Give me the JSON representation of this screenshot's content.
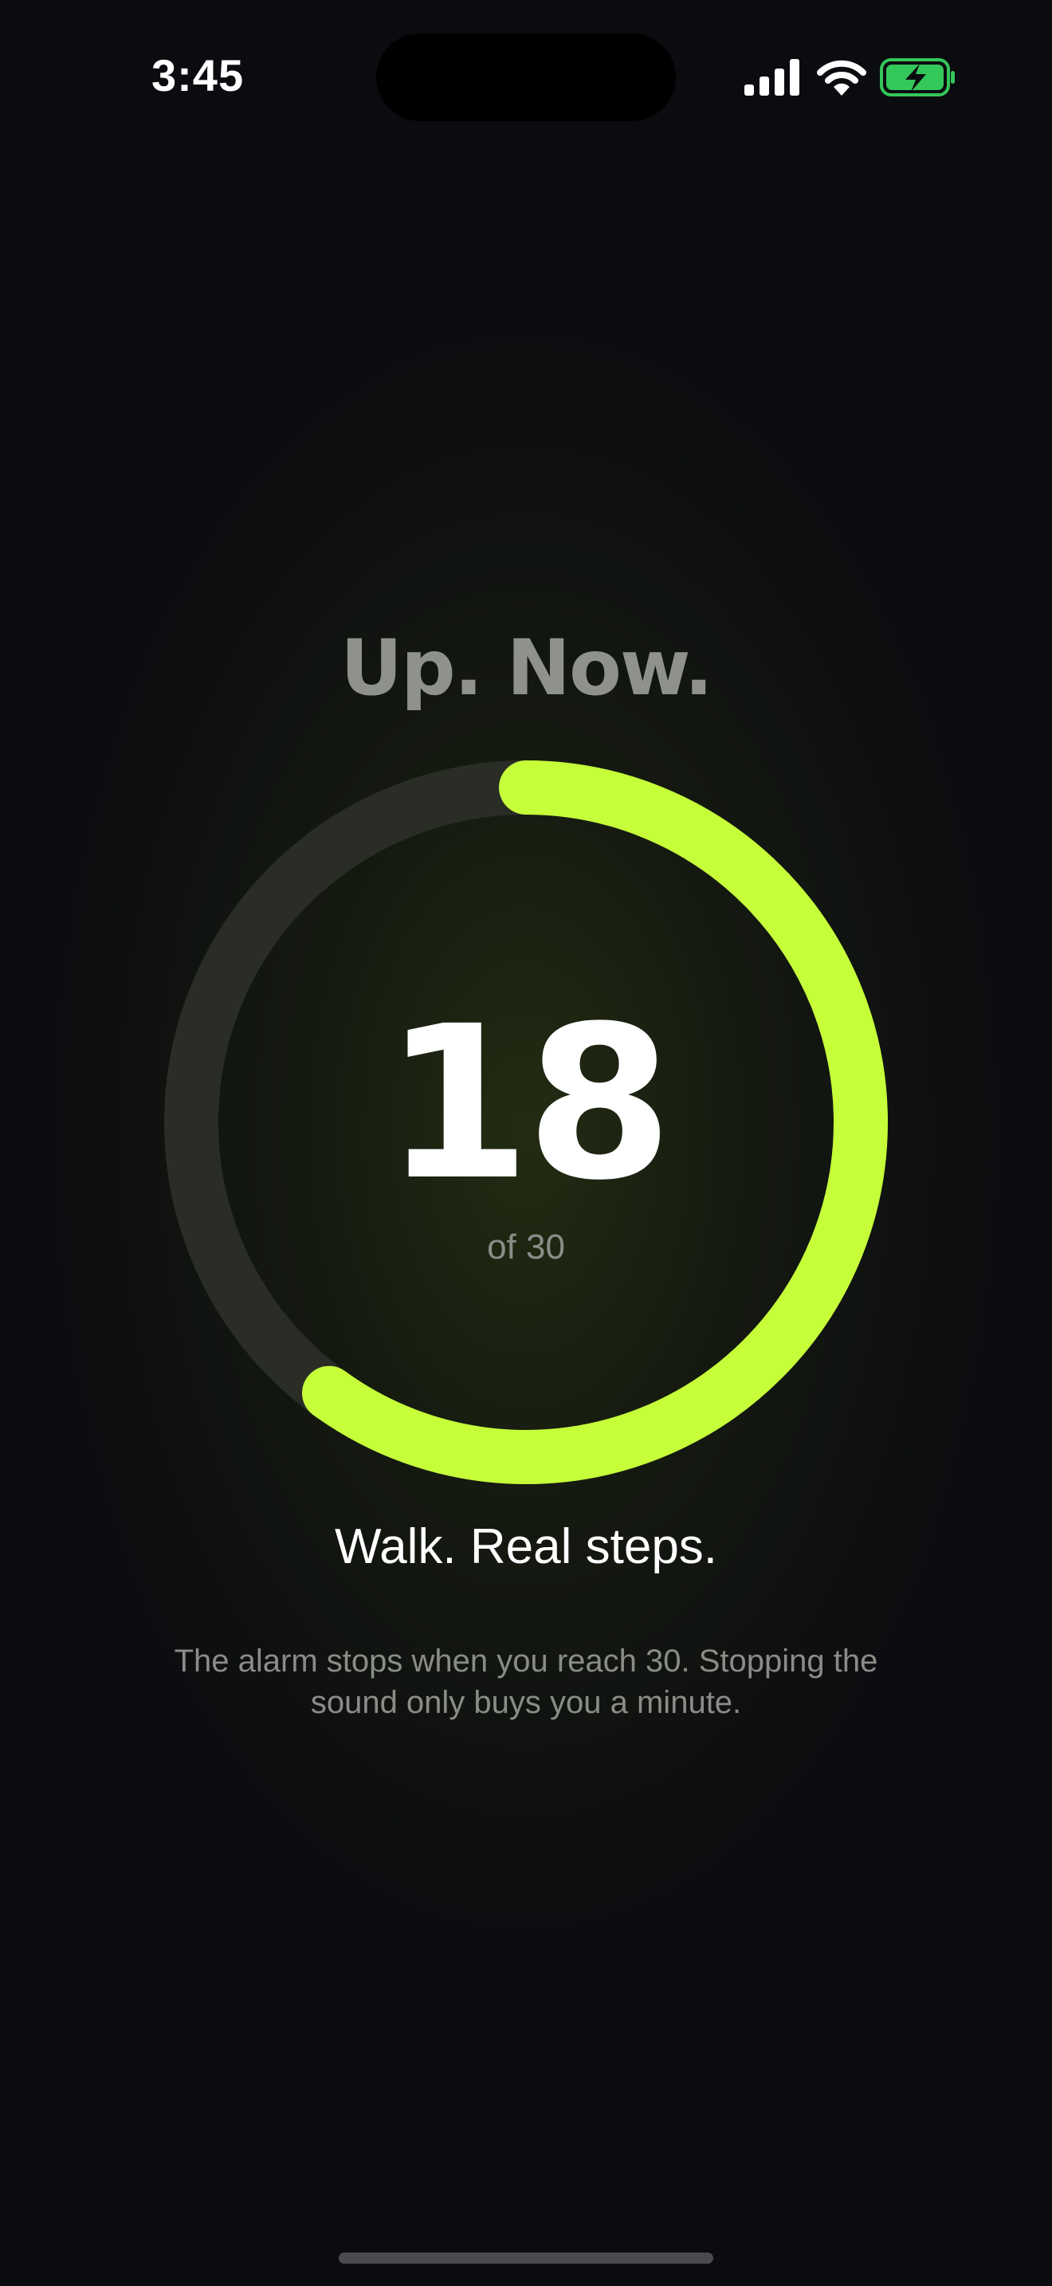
{
  "status_bar": {
    "time": "3:45",
    "icons": [
      "cellular-signal-icon",
      "wifi-icon",
      "battery-charging-icon"
    ],
    "battery_color": "#34c759"
  },
  "headline": "Up. Now.",
  "progress": {
    "current": "18",
    "total_label": "of 30",
    "fraction": 0.6,
    "accent_color": "#c6ff3a",
    "track_color": "#2a2c26"
  },
  "instruction": "Walk. Real steps.",
  "note": "The alarm stops when you reach 30. Stopping the sound only buys you a minute."
}
